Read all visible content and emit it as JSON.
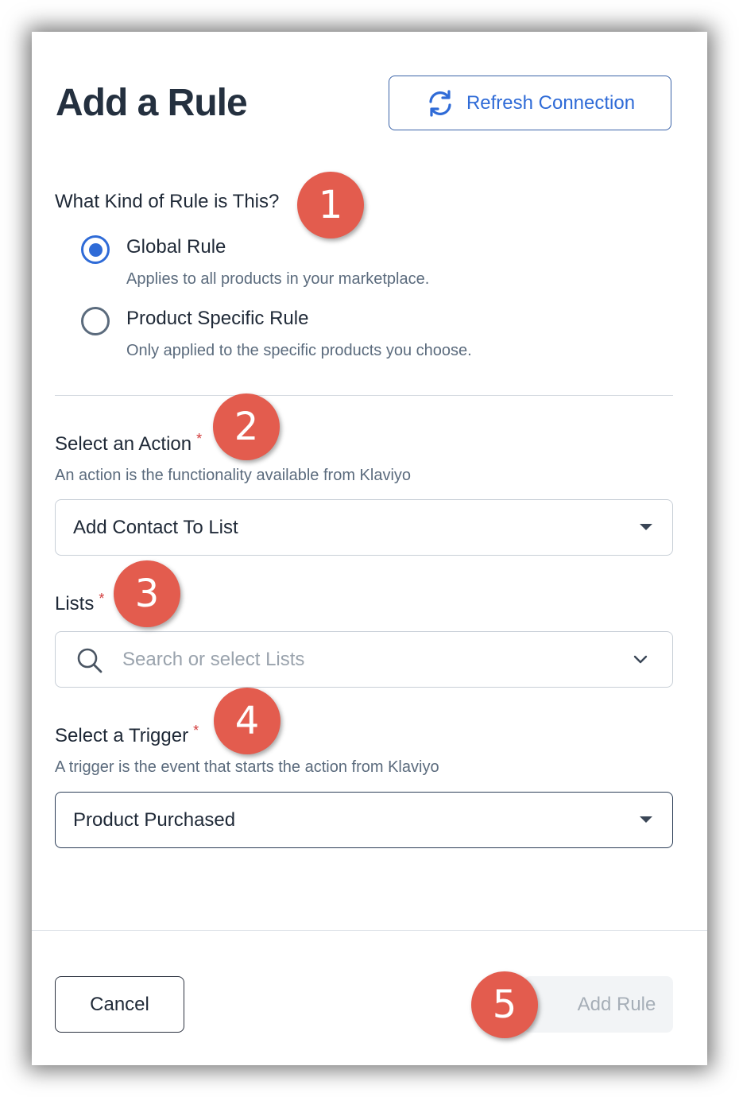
{
  "header": {
    "title": "Add a Rule",
    "refresh_label": "Refresh Connection"
  },
  "rule_kind": {
    "label": "What Kind of Rule is This?",
    "options": [
      {
        "label": "Global Rule",
        "description": "Applies to all products in your marketplace.",
        "selected": true
      },
      {
        "label": "Product Specific Rule",
        "description": "Only applied to the specific products you choose.",
        "selected": false
      }
    ]
  },
  "action": {
    "label": "Select an Action",
    "required_mark": "*",
    "help": "An action is the functionality available from Klaviyo",
    "value": "Add Contact To List"
  },
  "lists": {
    "label": "Lists",
    "required_mark": "*",
    "placeholder": "Search or select Lists"
  },
  "trigger": {
    "label": "Select a Trigger",
    "required_mark": "*",
    "help": "A trigger is the event that starts the action from Klaviyo",
    "value": "Product Purchased"
  },
  "footer": {
    "cancel_label": "Cancel",
    "add_label": "Add Rule"
  },
  "step_markers": [
    "1",
    "2",
    "3",
    "4",
    "5"
  ],
  "colors": {
    "accent": "#2f6bd7",
    "marker": "#e35c4e",
    "required": "#d23b3b",
    "title": "#24303f"
  },
  "icons": {
    "refresh": "refresh-icon",
    "search": "search-icon",
    "chevron": "chevron-down-icon",
    "caret": "caret-down-icon"
  }
}
